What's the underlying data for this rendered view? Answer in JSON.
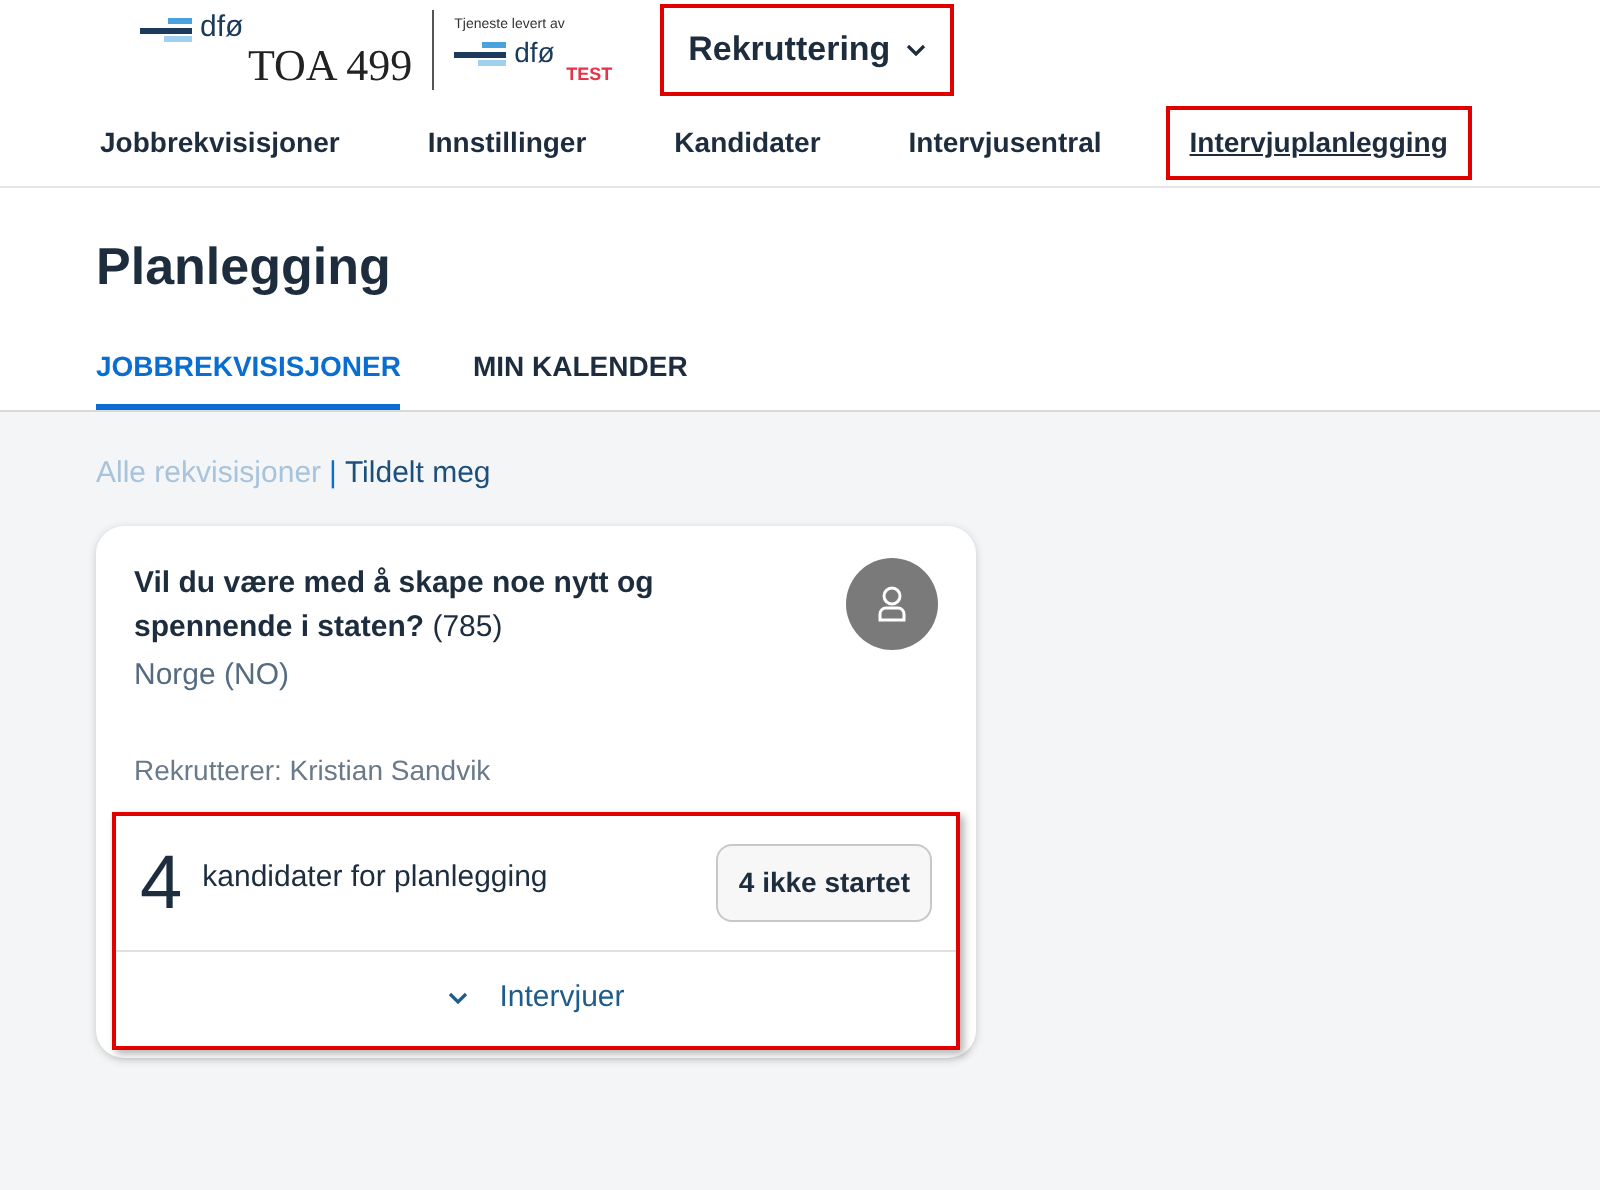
{
  "header": {
    "logo": {
      "org": "dfø",
      "title": "TOA 499"
    },
    "provider": {
      "caption": "Tjeneste levert av",
      "org": "dfø",
      "badge": "TEST"
    },
    "app_menu": {
      "label": "Rekruttering",
      "highlighted": true
    }
  },
  "nav": [
    {
      "label": "Jobbrekvisisjoner",
      "selected": false,
      "highlighted": false
    },
    {
      "label": "Innstillinger",
      "selected": false,
      "highlighted": false
    },
    {
      "label": "Kandidater",
      "selected": false,
      "highlighted": false
    },
    {
      "label": "Intervjusentral",
      "selected": false,
      "highlighted": false
    },
    {
      "label": "Intervjuplanlegging",
      "selected": true,
      "highlighted": true
    }
  ],
  "page_title": "Planlegging",
  "tabs": [
    {
      "label": "JOBBREKVISISJONER",
      "selected": true
    },
    {
      "label": "MIN KALENDER",
      "selected": false
    }
  ],
  "filters": {
    "separator": "|",
    "items": [
      {
        "label": "Alle rekvisisjoner",
        "selected": false
      },
      {
        "label": "Tildelt meg",
        "selected": true
      }
    ]
  },
  "card": {
    "title": "Vil du være med å skape noe nytt og spennende i staten?",
    "number": "(785)",
    "location": "Norge (NO)",
    "recruiter": "Rekrutterer: Kristian Sandvik",
    "count": "4",
    "count_label": "kandidater for planlegging",
    "status_button": "4 ikke startet",
    "expand_label": "Intervjuer",
    "expanded": false,
    "highlighted": true
  }
}
